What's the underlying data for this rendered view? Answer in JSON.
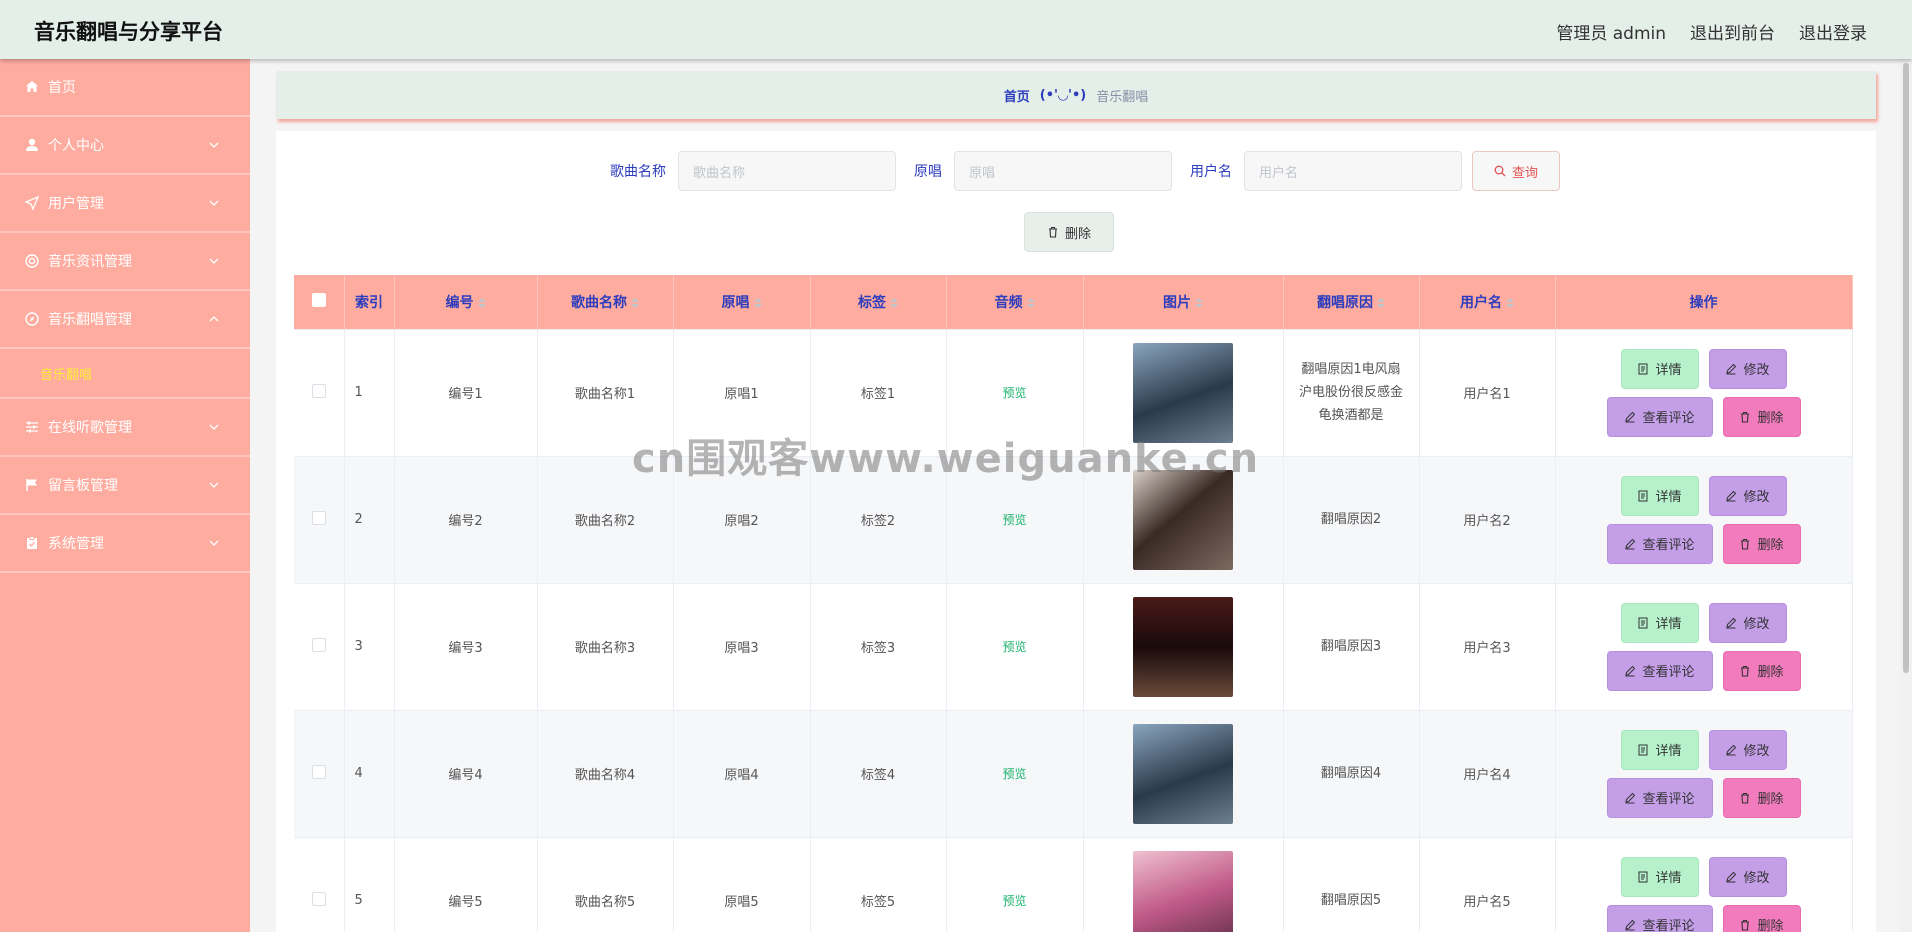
{
  "header": {
    "title": "音乐翻唱与分享平台",
    "nav": [
      "管理员 admin",
      "退出到前台",
      "退出登录"
    ]
  },
  "sidebar": {
    "items": [
      {
        "label": "首页",
        "icon": "home-icon",
        "chevron": false
      },
      {
        "label": "个人中心",
        "icon": "user-icon",
        "chevron": true
      },
      {
        "label": "用户管理",
        "icon": "send-icon",
        "chevron": true
      },
      {
        "label": "音乐资讯管理",
        "icon": "lifebuoy-icon",
        "chevron": true
      },
      {
        "label": "音乐翻唱管理",
        "icon": "compass-icon",
        "chevron": true,
        "expanded": true
      },
      {
        "label": "在线听歌管理",
        "icon": "sliders-icon",
        "chevron": true
      },
      {
        "label": "留言板管理",
        "icon": "flag-icon",
        "chevron": true
      },
      {
        "label": "系统管理",
        "icon": "clipboard-icon",
        "chevron": true
      }
    ],
    "submenu_active": "音乐翻唱"
  },
  "breadcrumb": {
    "home": "首页",
    "separator": "(•'◡'•)",
    "current": "音乐翻唱"
  },
  "search": {
    "fields": [
      {
        "label": "歌曲名称",
        "placeholder": "歌曲名称"
      },
      {
        "label": "原唱",
        "placeholder": "原唱"
      },
      {
        "label": "用户名",
        "placeholder": "用户名"
      }
    ],
    "query_label": "查询",
    "delete_label": "删除"
  },
  "table": {
    "columns": [
      "索引",
      "编号",
      "歌曲名称",
      "原唱",
      "标签",
      "音频",
      "图片",
      "翻唱原因",
      "用户名",
      "操作"
    ],
    "rows": [
      {
        "index": "1",
        "code": "编号1",
        "song": "歌曲名称1",
        "original": "原唱1",
        "tag": "标签1",
        "audio": "预览",
        "reason": "翻唱原因1电风扇沪电股份很反感金龟换酒都是",
        "user": "用户名1"
      },
      {
        "index": "2",
        "code": "编号2",
        "song": "歌曲名称2",
        "original": "原唱2",
        "tag": "标签2",
        "audio": "预览",
        "reason": "翻唱原因2",
        "user": "用户名2"
      },
      {
        "index": "3",
        "code": "编号3",
        "song": "歌曲名称3",
        "original": "原唱3",
        "tag": "标签3",
        "audio": "预览",
        "reason": "翻唱原因3",
        "user": "用户名3"
      },
      {
        "index": "4",
        "code": "编号4",
        "song": "歌曲名称4",
        "original": "原唱4",
        "tag": "标签4",
        "audio": "预览",
        "reason": "翻唱原因4",
        "user": "用户名4"
      },
      {
        "index": "5",
        "code": "编号5",
        "song": "歌曲名称5",
        "original": "原唱5",
        "tag": "标签5",
        "audio": "预览",
        "reason": "翻唱原因5",
        "user": "用户名5"
      }
    ],
    "actions": {
      "detail": "详情",
      "edit": "修改",
      "comment": "查看评论",
      "delete": "删除"
    }
  },
  "watermark": "cn围观客www.weiguanke.cn",
  "colors": {
    "header_bg": "#e3efe8",
    "sidebar_bg": "#ffaca0",
    "accent_blue": "#2d3dbd",
    "submenu_active": "#ffeb3b",
    "btn_detail": "#b6f1cc",
    "btn_edit": "#c59ee8",
    "btn_delete": "#f27bbd"
  }
}
